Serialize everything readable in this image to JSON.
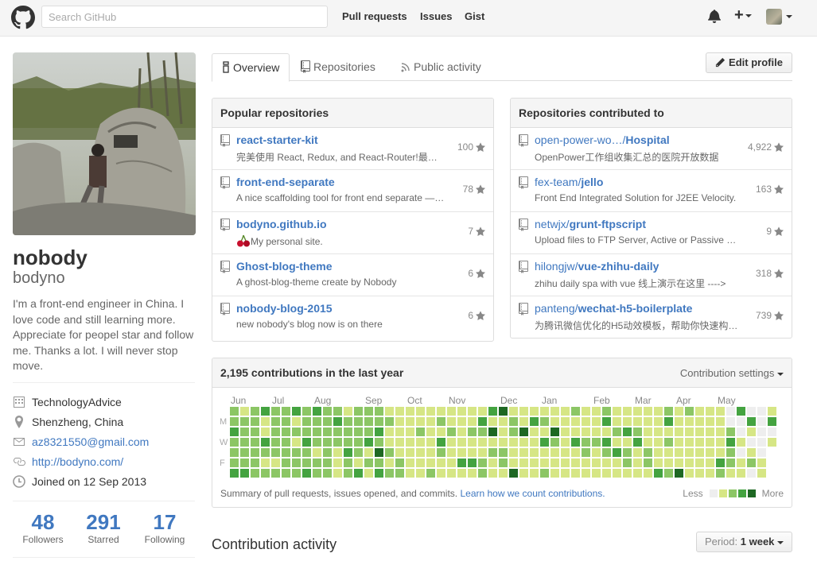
{
  "header": {
    "search_placeholder": "Search GitHub",
    "nav": [
      "Pull requests",
      "Issues",
      "Gist"
    ]
  },
  "profile": {
    "name": "nobody",
    "username": "bodyno",
    "bio": "I'm a front-end engineer in China. I love code and still learning more. Appreciate for peopel star and follow me. Thanks a lot. I will never stop move.",
    "company": "TechnologyAdvice",
    "location": "Shenzheng, China",
    "email": "az8321550@gmail.com",
    "website": "http://bodyno.com/",
    "joined": "Joined on 12 Sep 2013",
    "stats": [
      {
        "num": "48",
        "label": "Followers"
      },
      {
        "num": "291",
        "label": "Starred"
      },
      {
        "num": "17",
        "label": "Following"
      }
    ]
  },
  "tabs": [
    "Overview",
    "Repositories",
    "Public activity"
  ],
  "edit_profile": "Edit profile",
  "popular": {
    "title": "Popular repositories",
    "items": [
      {
        "name": "react-starter-kit",
        "desc": "完美使用 React, Redux, and React-Router!最…",
        "stars": "100"
      },
      {
        "name": "front-end-separate",
        "desc": "A nice scaffolding tool for front end separate —…",
        "stars": "78"
      },
      {
        "name": "bodyno.github.io",
        "desc": "My personal site.",
        "stars": "7"
      },
      {
        "name": "Ghost-blog-theme",
        "desc": "A ghost-blog-theme create by Nobody",
        "stars": "6"
      },
      {
        "name": "nobody-blog-2015",
        "desc": "new nobody's blog now is on there",
        "stars": "6"
      }
    ]
  },
  "contributed": {
    "title": "Repositories contributed to",
    "items": [
      {
        "owner": "open-power-wo…/",
        "name": "Hospital",
        "desc": "OpenPower工作组收集汇总的医院开放数据",
        "stars": "4,922"
      },
      {
        "owner": "fex-team/",
        "name": "jello",
        "desc": "Front End Integrated Solution for J2EE Velocity.",
        "stars": "163"
      },
      {
        "owner": "netwjx/",
        "name": "grunt-ftpscript",
        "desc": "Upload files to FTP Server, Active or Passive …",
        "stars": "9"
      },
      {
        "owner": "hilongjw/",
        "name": "vue-zhihu-daily",
        "desc": "zhihu daily spa with vue 线上演示在这里 ---->",
        "stars": "318"
      },
      {
        "owner": "panteng/",
        "name": "wechat-h5-boilerplate",
        "desc": "为腾讯微信优化的H5动效模板，帮助你快速构…",
        "stars": "739"
      }
    ]
  },
  "contributions": {
    "title": "2,195 contributions in the last year",
    "settings": "Contribution settings",
    "months": [
      "Jun",
      "Jul",
      "Aug",
      "Sep",
      "Oct",
      "Nov",
      "Dec",
      "Jan",
      "Feb",
      "Mar",
      "Apr",
      "May"
    ],
    "day_labels": [
      "M",
      "W",
      "F"
    ],
    "footer_text": "Summary of pull requests, issues opened, and commits.",
    "footer_link": "Learn how we count contributions.",
    "legend_less": "Less",
    "legend_more": "More",
    "colors": [
      "#eeeeee",
      "#d6e685",
      "#8cc665",
      "#44a340",
      "#1e6823"
    ]
  },
  "activity": {
    "title": "Contribution activity",
    "period_label": "Period:",
    "period_value": "1 week"
  }
}
